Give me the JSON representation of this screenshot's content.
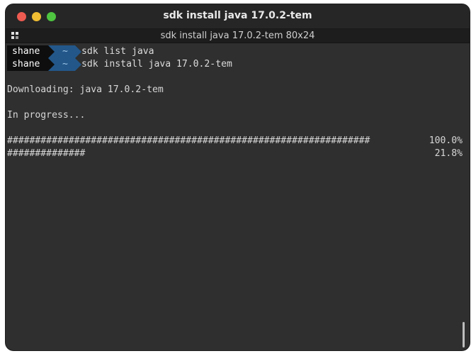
{
  "window": {
    "title": "sdk install java 17.0.2-tem"
  },
  "tab": {
    "title": "sdk install java 17.0.2-tem 80x24",
    "icon": "grid-icon"
  },
  "prompts": [
    {
      "user": "shane",
      "dir": "~",
      "command": "sdk list java"
    },
    {
      "user": "shane",
      "dir": "~",
      "command": "sdk install java 17.0.2-tem"
    }
  ],
  "output": {
    "downloading": "Downloading: java 17.0.2-tem",
    "progress_text": "In progress..."
  },
  "progress_bars": [
    {
      "hashes": "#################################################################",
      "percent": "100.0%"
    },
    {
      "hashes": "##############",
      "percent": "21.8%"
    }
  ],
  "colors": {
    "background": "#2f2f2f",
    "user_segment": "#0e0e0e",
    "dir_segment": "#23578a",
    "close": "#ee5b51",
    "minimize": "#f0bd33",
    "maximize": "#4ec440"
  }
}
